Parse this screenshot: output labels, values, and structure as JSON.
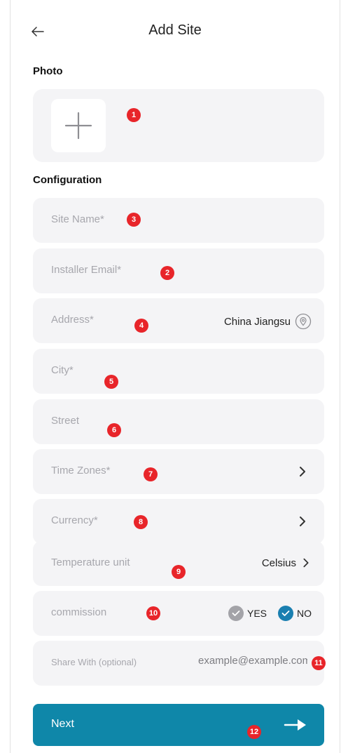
{
  "header": {
    "title": "Add Site"
  },
  "sections": {
    "photo": "Photo",
    "configuration": "Configuration"
  },
  "fields": {
    "site_name": {
      "placeholder": "Site Name*"
    },
    "installer_email": {
      "placeholder": "Installer Email*"
    },
    "address": {
      "placeholder": "Address*",
      "value": "China Jiangsu"
    },
    "city": {
      "placeholder": "City*"
    },
    "street": {
      "placeholder": "Street"
    },
    "time_zones": {
      "placeholder": "Time Zones*"
    },
    "currency": {
      "placeholder": "Currency*"
    },
    "temperature_unit": {
      "placeholder": "Temperature unit",
      "value": "Celsius"
    },
    "commission": {
      "placeholder": "commission",
      "yes_label": "YES",
      "no_label": "NO",
      "selected": "NO"
    },
    "share_with": {
      "placeholder": "Share With (optional)",
      "value": "example@example.com"
    }
  },
  "next_button": {
    "label": "Next"
  },
  "badges": [
    "1",
    "2",
    "3",
    "4",
    "5",
    "6",
    "7",
    "8",
    "9",
    "10",
    "11",
    "12"
  ],
  "colors": {
    "accent": "#0f87a9",
    "badge": "#e8252a",
    "field_bg": "#f4f4f6",
    "radio_unselected": "#a3a3a8",
    "radio_selected": "#1a7fb0"
  },
  "icons": {
    "back": "arrow-left-icon",
    "add_photo": "plus-icon",
    "location": "location-pin-icon",
    "chevron": "chevron-right-icon",
    "check": "check-icon",
    "next": "arrow-right-icon"
  }
}
